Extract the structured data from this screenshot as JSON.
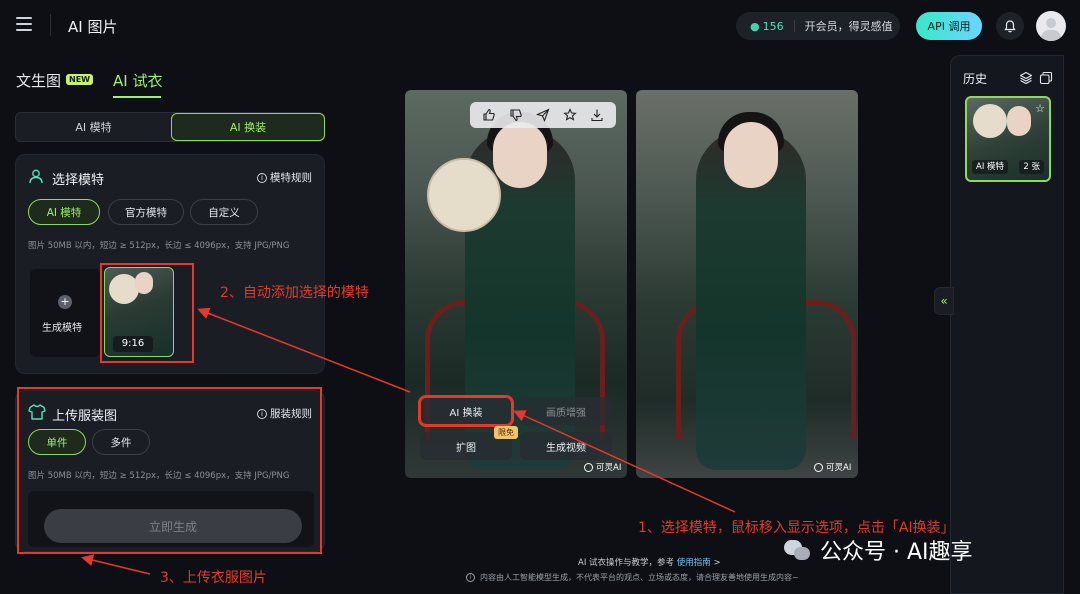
{
  "header": {
    "app_title": "AI 图片",
    "credits": "156",
    "membership_text": "开会员，得灵感值",
    "api_button": "API 调用"
  },
  "tabs": {
    "text_to_image": "文生图",
    "new_badge": "NEW",
    "try_on": "AI 试衣"
  },
  "segment": {
    "ai_model": "AI 模特",
    "ai_swap": "AI 换装"
  },
  "model_card": {
    "title": "选择模特",
    "rules": "模特规则",
    "chips": [
      "AI 模特",
      "官方模特",
      "自定义"
    ],
    "hint": "图片 50MB 以内，短边 ≥ 512px，长边 ≤ 4096px，支持 JPG/PNG",
    "generate_model": "生成模特",
    "ratio": "9:16"
  },
  "cloth_card": {
    "title": "上传服装图",
    "rules": "服装规则",
    "chips": [
      "单件",
      "多件"
    ],
    "hint": "图片 50MB 以内，短边 ≥ 512px，长边 ≤ 4096px，支持 JPG/PNG",
    "generate_button": "立即生成"
  },
  "image_actions": {
    "ai_swap": "AI 换装",
    "enhance": "画质增强",
    "expand": "扩图",
    "video": "生成视频",
    "free_badge": "限免",
    "watermark": "可灵AI"
  },
  "history": {
    "title": "历史",
    "tag_model": "AI 模特",
    "tag_count": "2 张"
  },
  "annotations": {
    "step1": "1、选择模特，鼠标移入显示选项，点击「AI换装」",
    "step2": "2、自动添加选择的模特",
    "step3": "3、上传衣服图片"
  },
  "footer": {
    "line1_prefix": "AI 试衣操作与教学，参考 ",
    "line1_link": "使用指南",
    "line1_suffix": " >",
    "line2": "内容由人工智能模型生成，不代表平台的观点、立场或态度，请合理友善地使用生成内容~"
  },
  "wechat": {
    "text": "公众号 · AI趣享"
  }
}
